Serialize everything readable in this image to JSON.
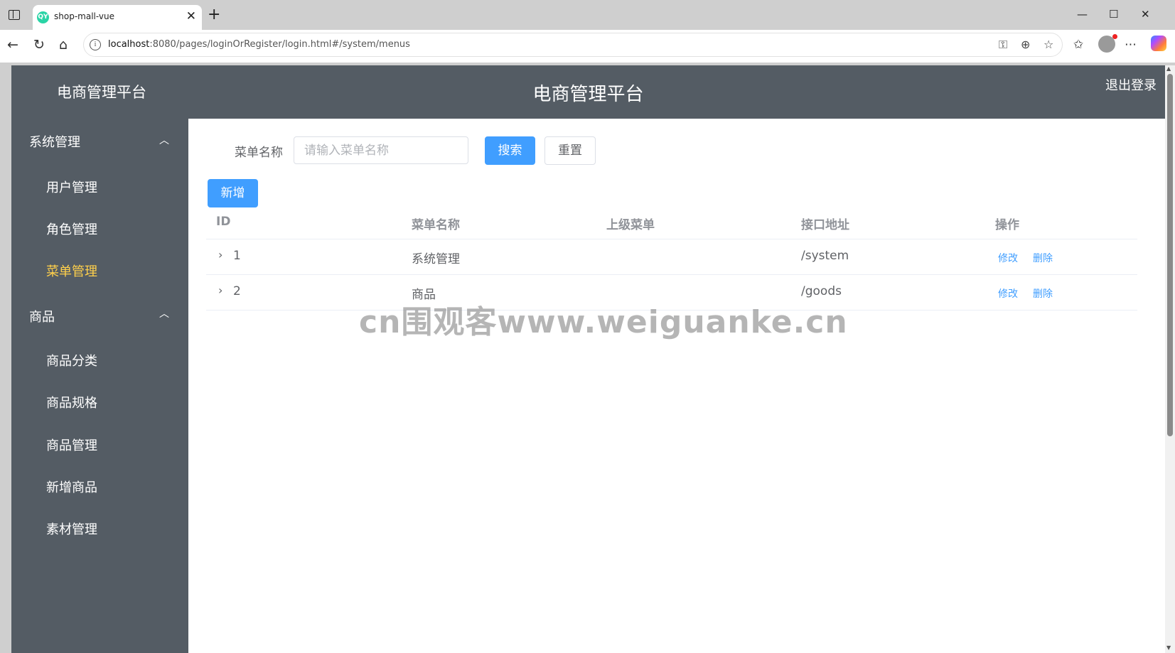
{
  "browser": {
    "tab_title": "shop-mall-vue",
    "tab_favicon": "QY",
    "url_host": "localhost",
    "url_rest": ":8080/pages/loginOrRegister/login.html#/system/menus"
  },
  "app": {
    "brand": "电商管理平台",
    "header_title": "电商管理平台",
    "logout": "退出登录"
  },
  "sidebar": {
    "groups": [
      {
        "label": "系统管理",
        "items": [
          "用户管理",
          "角色管理",
          "菜单管理"
        ]
      },
      {
        "label": "商品",
        "items": [
          "商品分类",
          "商品规格",
          "商品管理",
          "新增商品",
          "素材管理"
        ]
      }
    ],
    "active_item": "菜单管理"
  },
  "search": {
    "label": "菜单名称",
    "placeholder": "请输入菜单名称",
    "search_button": "搜索",
    "reset_button": "重置"
  },
  "toolbar": {
    "add_button": "新增"
  },
  "table": {
    "headers": [
      "ID",
      "菜单名称",
      "上级菜单",
      "接口地址",
      "操作"
    ],
    "rows": [
      {
        "id": "1",
        "name": "系统管理",
        "parent": "",
        "path": "/system",
        "edit": "修改",
        "delete": "删除"
      },
      {
        "id": "2",
        "name": "商品",
        "parent": "",
        "path": "/goods",
        "edit": "修改",
        "delete": "删除"
      }
    ]
  },
  "watermark": "cn围观客www.weiguanke.cn",
  "colors": {
    "sidebar": "#545c64",
    "active": "#ffd04b",
    "primary": "#409eff"
  }
}
